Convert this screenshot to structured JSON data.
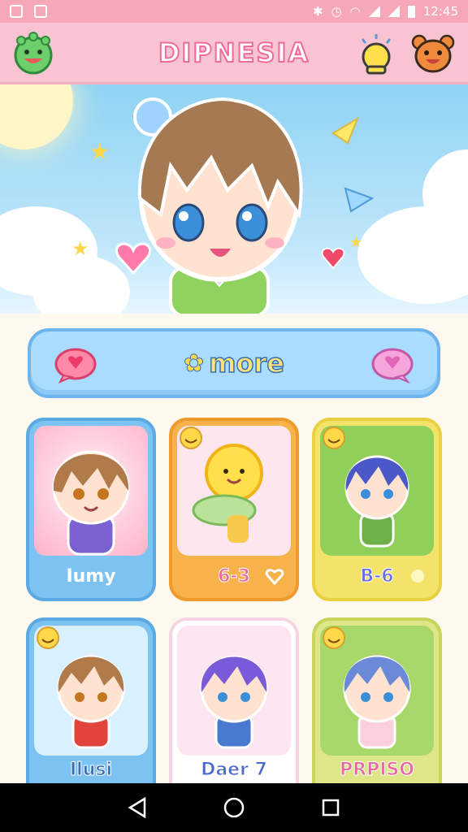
{
  "status_bar": {
    "time": "12:45"
  },
  "app": {
    "title": "DIPNESIA"
  },
  "more_button": {
    "label": "more"
  },
  "cards": [
    {
      "name": "Iumy"
    },
    {
      "name": "6-3"
    },
    {
      "name": "B-6"
    },
    {
      "name": "Ilusi"
    },
    {
      "name": "Daer 7"
    },
    {
      "name": "PRPISO"
    }
  ],
  "colors": {
    "header_pink": "#f9c4d2",
    "accent_pink": "#f06a9b",
    "card_blue": "#7cc3f2",
    "card_orange": "#f7b24b",
    "card_yellow": "#f3e36a",
    "card_green_yellow": "#dfe68a"
  },
  "icons": {
    "header_left": "green-dino-icon",
    "header_right_1": "lightbulb-icon",
    "header_right_2": "bear-icon",
    "nav_back": "back-triangle-icon",
    "nav_home": "home-circle-icon",
    "nav_recent": "recent-square-icon"
  }
}
